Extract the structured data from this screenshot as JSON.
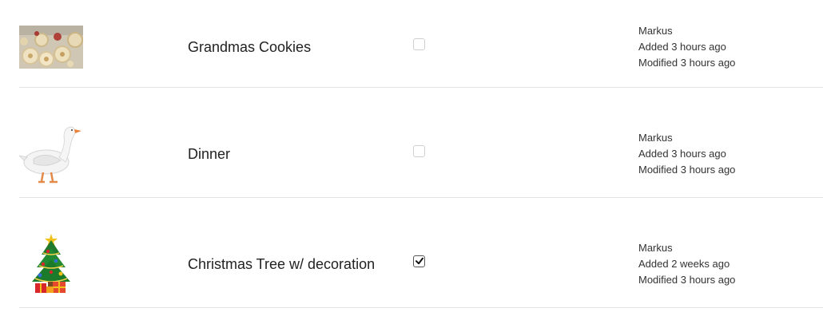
{
  "items": [
    {
      "title": "Grandmas Cookies",
      "checked": false,
      "author": "Markus",
      "added": "Added 3 hours ago",
      "modified": "Modified 3 hours ago",
      "thumbnail_icon": "cookies-photo"
    },
    {
      "title": "Dinner",
      "checked": false,
      "author": "Markus",
      "added": "Added 3 hours ago",
      "modified": "Modified 3 hours ago",
      "thumbnail_icon": "goose-photo"
    },
    {
      "title": "Christmas Tree w/ decoration",
      "checked": true,
      "author": "Markus",
      "added": "Added 2 weeks ago",
      "modified": "Modified 3 hours ago",
      "thumbnail_icon": "christmas-tree-photo"
    }
  ]
}
